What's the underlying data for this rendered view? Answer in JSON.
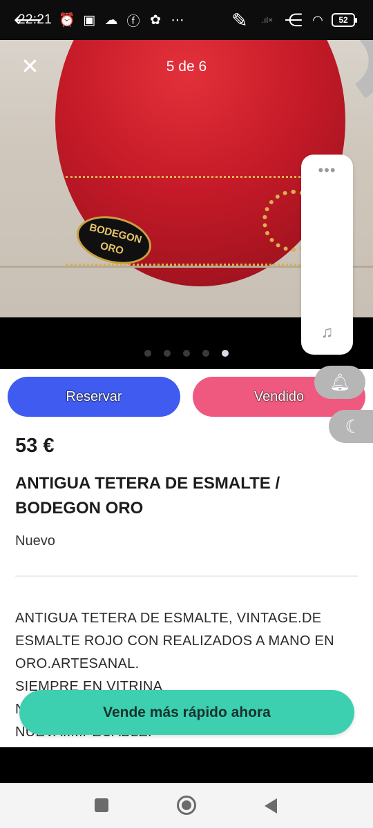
{
  "status_bar": {
    "time": "22:21",
    "battery": "52",
    "icons_left": [
      "alarm-icon",
      "nfc-icon",
      "cloud-icon",
      "facebook-icon",
      "chat-icon",
      "more-notifications-icon"
    ],
    "icons_right": [
      "edit-pencil-icon",
      "share-icon",
      "signal-icon",
      "wifi-icon",
      "battery-icon"
    ]
  },
  "gallery": {
    "counter": "5 de 6",
    "total_images": 6,
    "current_index": 5,
    "badge_text": "BODEGON ORO"
  },
  "actions": {
    "reserve_label": "Reservar",
    "sold_label": "Vendido"
  },
  "product": {
    "price": "53 €",
    "title": "ANTIGUA TETERA  DE ESMALTE / BODEGON ORO",
    "condition": "Nuevo",
    "description": "ANTIGUA TETERA DE ESMALTE, VINTAGE.DE ESMALTE ROJO CON REALIZADOS A MANO EN ORO.ARTESANAL.\nSIEMPRE EN VITRINA\nN\nNUEVA.IMPECABLE."
  },
  "cta": {
    "label": "Vende más rápido ahora"
  },
  "colors": {
    "reserve": "#3f5bf0",
    "sold": "#f0597f",
    "cta": "#3dd0b0"
  }
}
